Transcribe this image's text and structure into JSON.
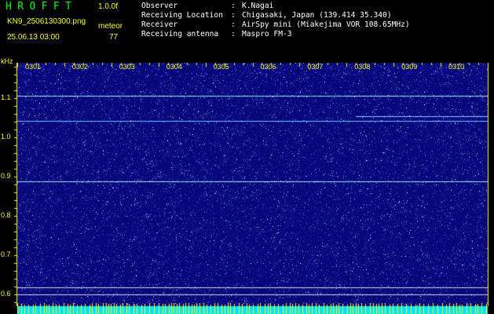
{
  "header": {
    "logo": "HROFFT",
    "version": "1.0.0f",
    "filename": "KN9_2506130300.png",
    "meteor_label": "meteor",
    "datetime": "25.06.13 03:00",
    "meteor_count": "77"
  },
  "info": [
    {
      "key": "Observer",
      "value": "K.Nagai"
    },
    {
      "key": "Receiving Location",
      "value": "Chigasaki, Japan (139.414 35.340)"
    },
    {
      "key": "Receiver",
      "value": "AirSpy mini (Miakejima VOR 108.65MHz)"
    },
    {
      "key": "Receiving antenna",
      "value": "Maspro FM-3"
    }
  ],
  "colors": {
    "background": "#000000",
    "plot_bg": "#08087a",
    "noise": "#3a62ff",
    "label": "#ffff00",
    "logo": "#00ff00",
    "bottom_band": "#00e5ff"
  },
  "chart_data": {
    "type": "heatmap",
    "ylabel": "kHz",
    "x": [
      "0301",
      "0302",
      "0303",
      "0304",
      "0305",
      "0306",
      "0307",
      "0308",
      "0309",
      "0310"
    ],
    "y_ticks": [
      "1.1",
      "1.0",
      "0.9",
      "0.8",
      "0.7",
      "0.6"
    ],
    "ylim": [
      0.57,
      1.19
    ],
    "horizontal_lines_khz": [
      1.107,
      1.043,
      0.888
    ],
    "partial_line": {
      "khz": 1.054,
      "from_fraction": 0.72
    },
    "reference_lines_khz": [
      0.618,
      0.6
    ]
  }
}
